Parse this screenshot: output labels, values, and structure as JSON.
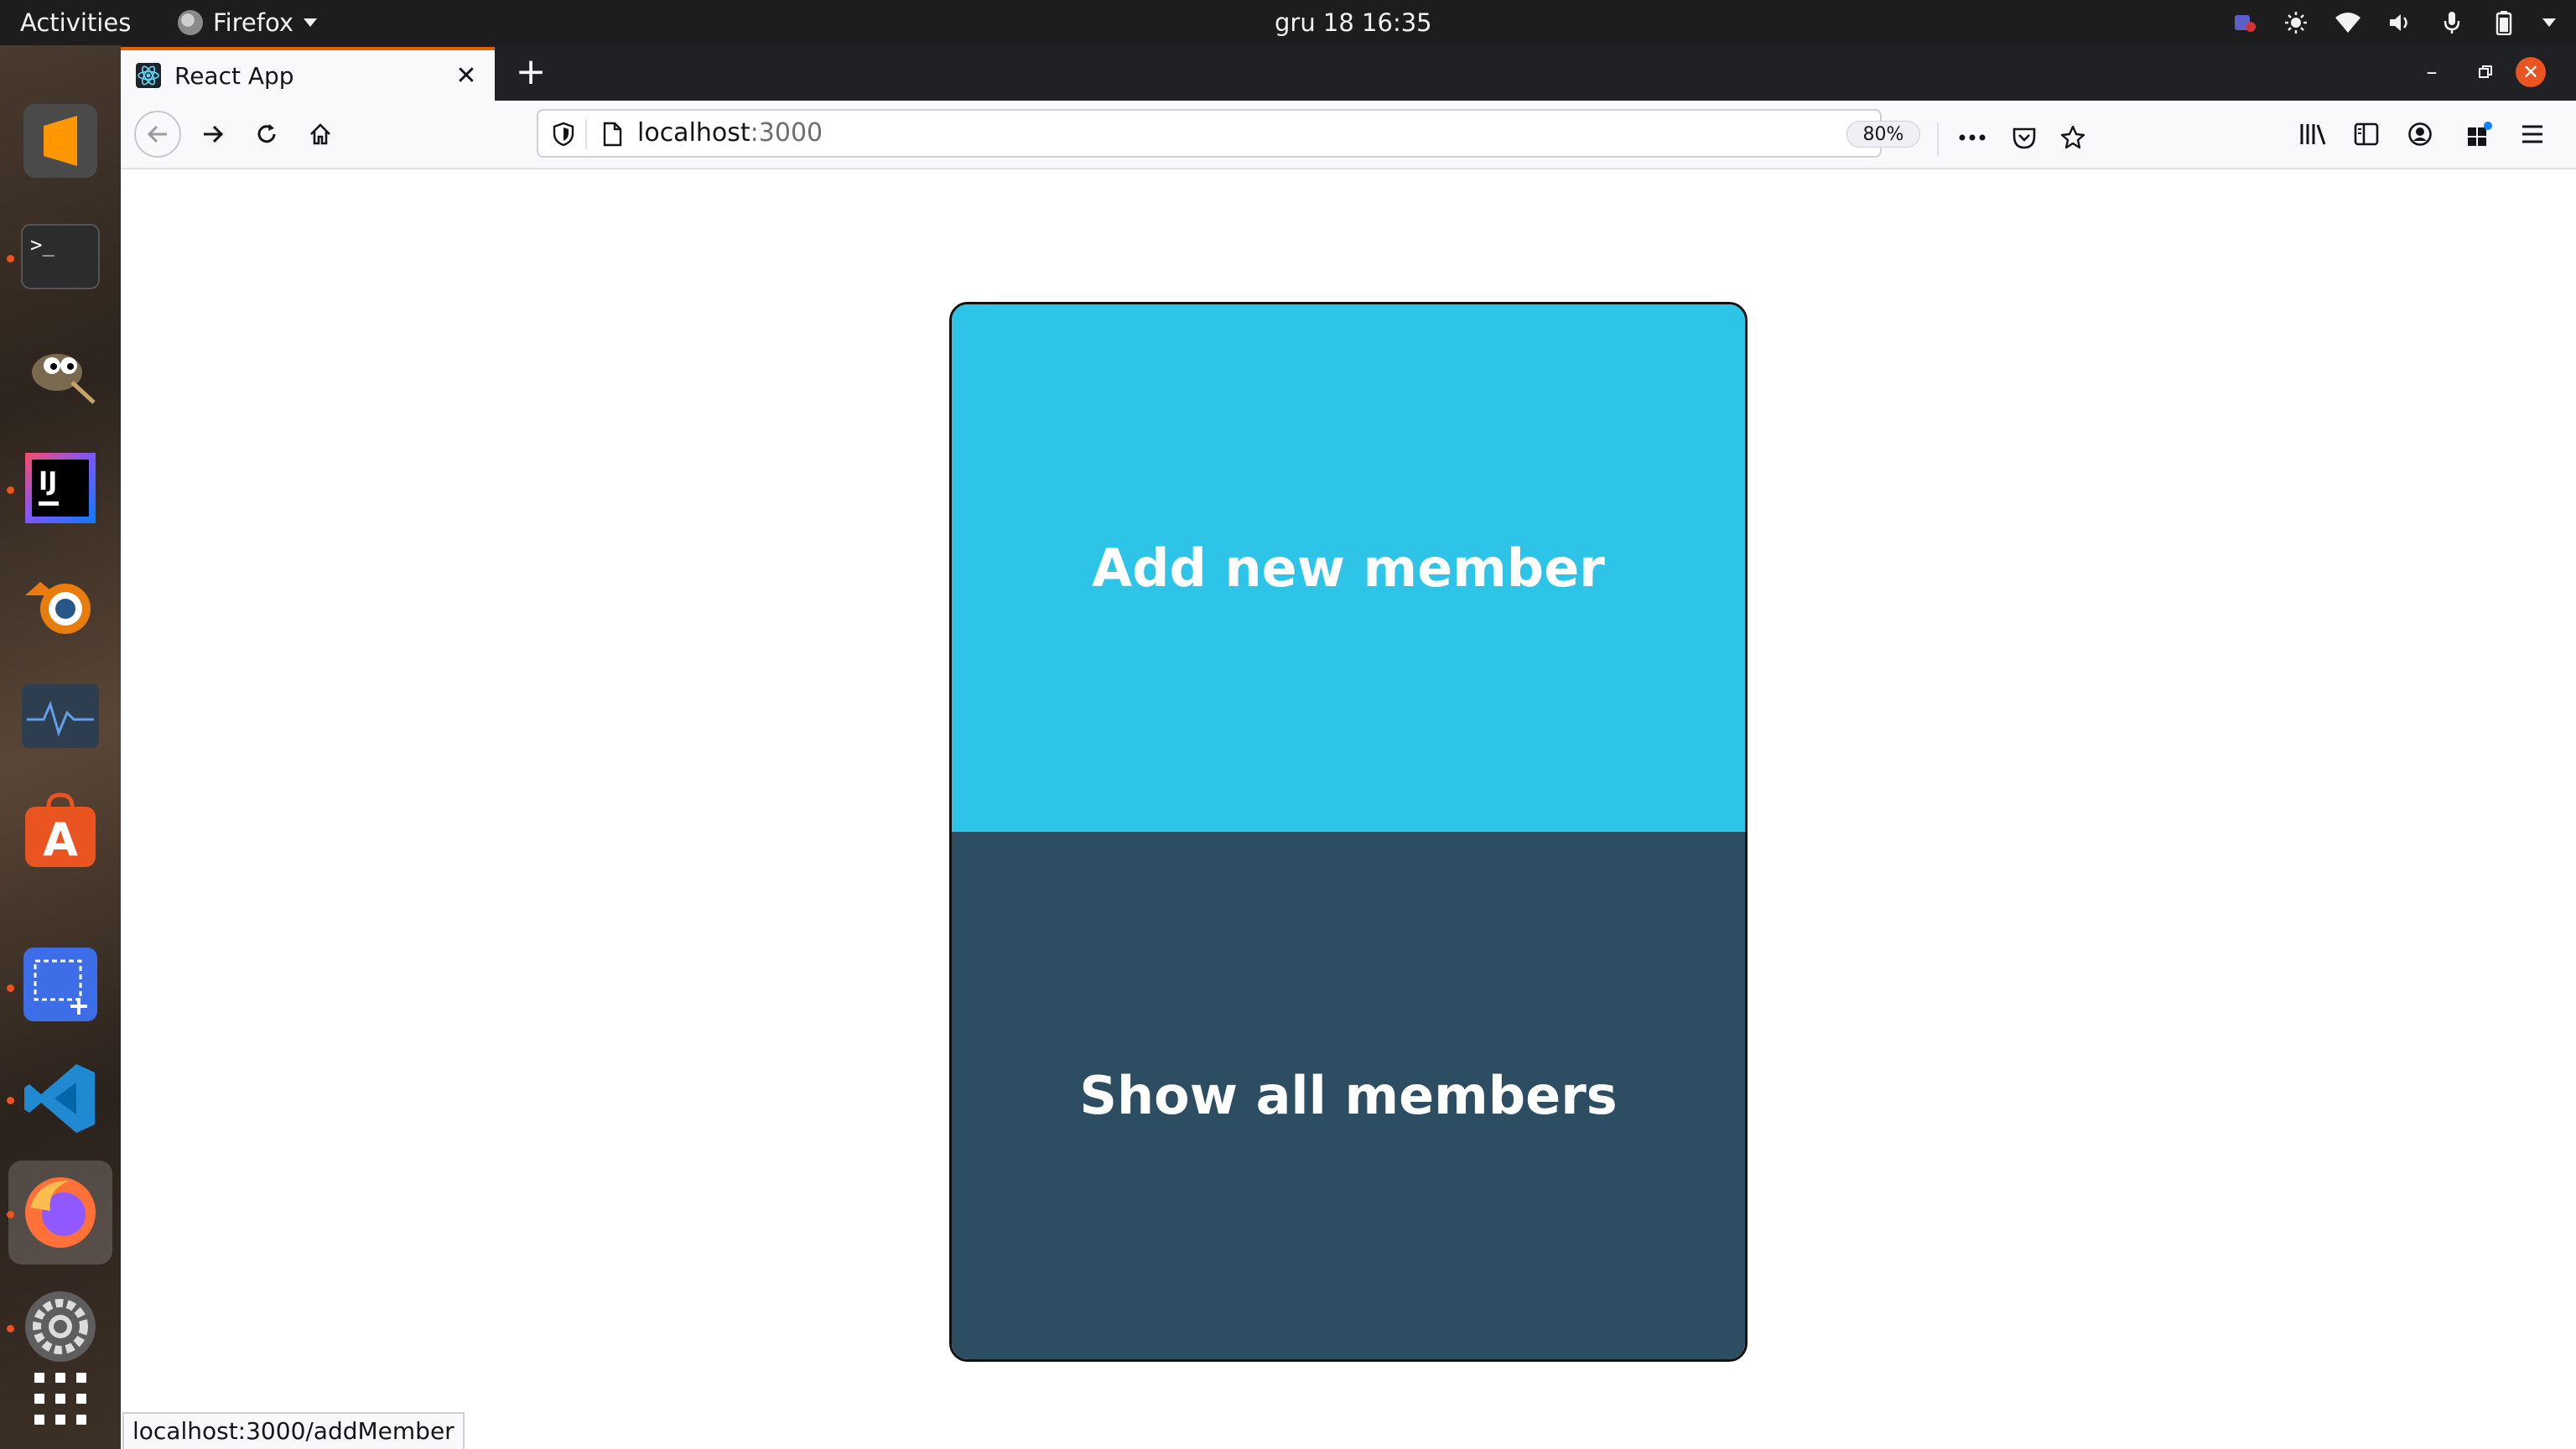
{
  "topbar": {
    "activities": "Activities",
    "app_name": "Firefox",
    "clock": "gru 18  16:35"
  },
  "dock": {
    "items": [
      {
        "name": "sublime-text-icon",
        "color": "#f57c00"
      },
      {
        "name": "terminal-icon",
        "color": "#2c2c2c"
      },
      {
        "name": "gimp-icon",
        "color": "#8c7a5b"
      },
      {
        "name": "intellij-idea-icon",
        "color": "#000000"
      },
      {
        "name": "blender-icon",
        "color": "#e87d0d"
      },
      {
        "name": "system-monitor-icon",
        "color": "#2d3e50"
      },
      {
        "name": "software-center-icon",
        "color": "#e95420"
      },
      {
        "name": "screenshot-icon",
        "color": "#3d6ee8"
      },
      {
        "name": "vscode-icon",
        "color": "#1f8ad2"
      },
      {
        "name": "firefox-icon",
        "color": "#ff7139"
      },
      {
        "name": "settings-icon",
        "color": "#6b6b6b"
      },
      {
        "name": "show-apps-icon",
        "color": "#ffffff"
      }
    ]
  },
  "browser": {
    "tab_title": "React App",
    "url_host": "localhost",
    "url_port": ":3000",
    "zoom": "80%",
    "status_url": "localhost:3000/addMember"
  },
  "page": {
    "add_button": "Add new member",
    "show_button": "Show all members",
    "colors": {
      "add": "#2ec4e8",
      "show": "#2d4e62"
    }
  }
}
